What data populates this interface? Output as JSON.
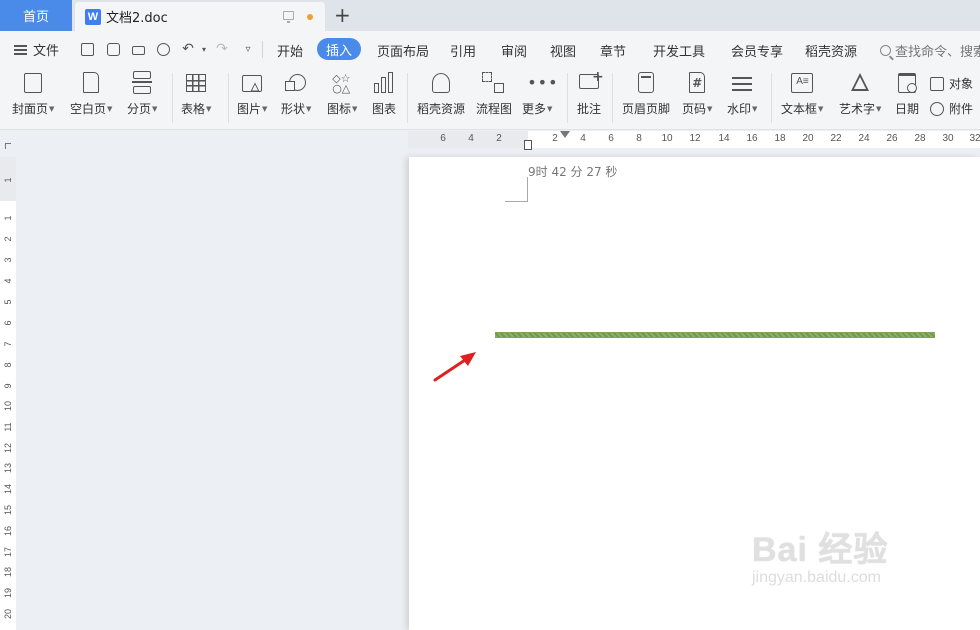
{
  "titlebar": {
    "home_tab": "首页",
    "doc_tab": "文档2.doc",
    "doc_icon_letter": "W",
    "new_tab_symbol": "+"
  },
  "menubar": {
    "file_label": "文件",
    "items": [
      "开始",
      "插入",
      "页面布局",
      "引用",
      "审阅",
      "视图",
      "章节",
      "开发工具",
      "会员专享",
      "稻壳资源"
    ],
    "active_item": "插入",
    "search_text": "查找命令、搜索"
  },
  "ribbon": {
    "buttons": [
      {
        "label": "封面页",
        "caret": true
      },
      {
        "label": "空白页",
        "caret": true
      },
      {
        "label": "分页",
        "caret": true
      },
      {
        "label": "表格",
        "caret": true
      },
      {
        "label": "图片",
        "caret": true
      },
      {
        "label": "形状",
        "caret": true
      },
      {
        "label": "图标",
        "caret": true
      },
      {
        "label": "图表",
        "caret": false
      },
      {
        "label": "稻壳资源",
        "caret": false
      },
      {
        "label": "流程图",
        "caret": false
      },
      {
        "label": "更多",
        "caret": true
      },
      {
        "label": "批注",
        "caret": false
      },
      {
        "label": "页眉页脚",
        "caret": false
      },
      {
        "label": "页码",
        "caret": true
      },
      {
        "label": "水印",
        "caret": true
      },
      {
        "label": "文本框",
        "caret": true
      },
      {
        "label": "艺术字",
        "caret": true
      },
      {
        "label": "日期",
        "caret": false
      }
    ],
    "side_object": "对象",
    "side_attach": "附件"
  },
  "hruler": {
    "labels": [
      "6",
      "4",
      "2",
      "2",
      "4",
      "6",
      "8",
      "10",
      "12",
      "14",
      "16",
      "18",
      "20",
      "22",
      "24",
      "26",
      "28",
      "30",
      "32"
    ]
  },
  "vruler": {
    "labels": [
      "1",
      "1",
      "2",
      "3",
      "4",
      "5",
      "6",
      "7",
      "8",
      "9",
      "10",
      "11",
      "12",
      "13",
      "14",
      "15",
      "16",
      "17",
      "18",
      "19",
      "20"
    ]
  },
  "document": {
    "text_line": "9时 42 分 27 秒"
  },
  "colors": {
    "accent": "#4a8ae8",
    "line_green": "#7fa35a",
    "arrow_red": "#e02020"
  },
  "watermark": {
    "main": "Bai  经验",
    "sub": "jingyan.baidu.com"
  }
}
